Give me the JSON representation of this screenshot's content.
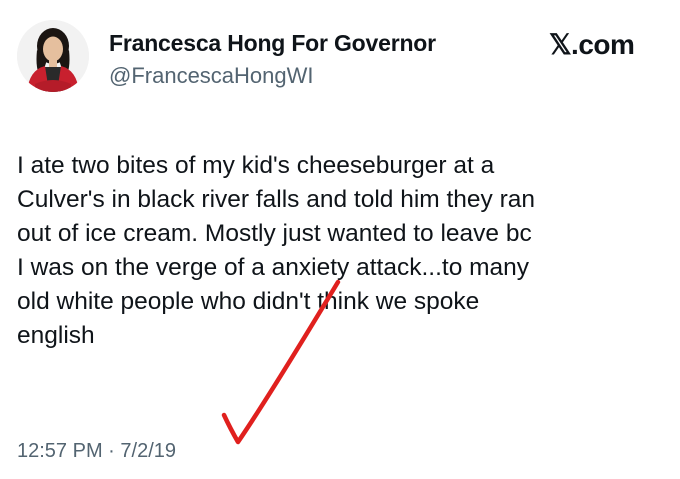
{
  "tweet": {
    "display_name": "Francesca Hong For Governor",
    "handle": "@FrancescaHongWI",
    "brand": "𝕏.com",
    "body_lines": [
      "I ate two bites of my kid's cheeseburger at a",
      "Culver's in black river falls and told him they ran",
      "out of ice cream. Mostly just wanted to leave bc",
      "I was on the verge of a anxiety attack...to many",
      "old white people who didn't think we spoke",
      "english"
    ],
    "time": "12:57 PM",
    "separator": "·",
    "date": "7/2/19"
  },
  "colors": {
    "text": "#0f1419",
    "muted": "#536471",
    "check_mark": "#e0201e",
    "avatar_jacket": "#c8202e"
  },
  "icons": {
    "avatar": "profile-photo",
    "check": "red-checkmark"
  }
}
